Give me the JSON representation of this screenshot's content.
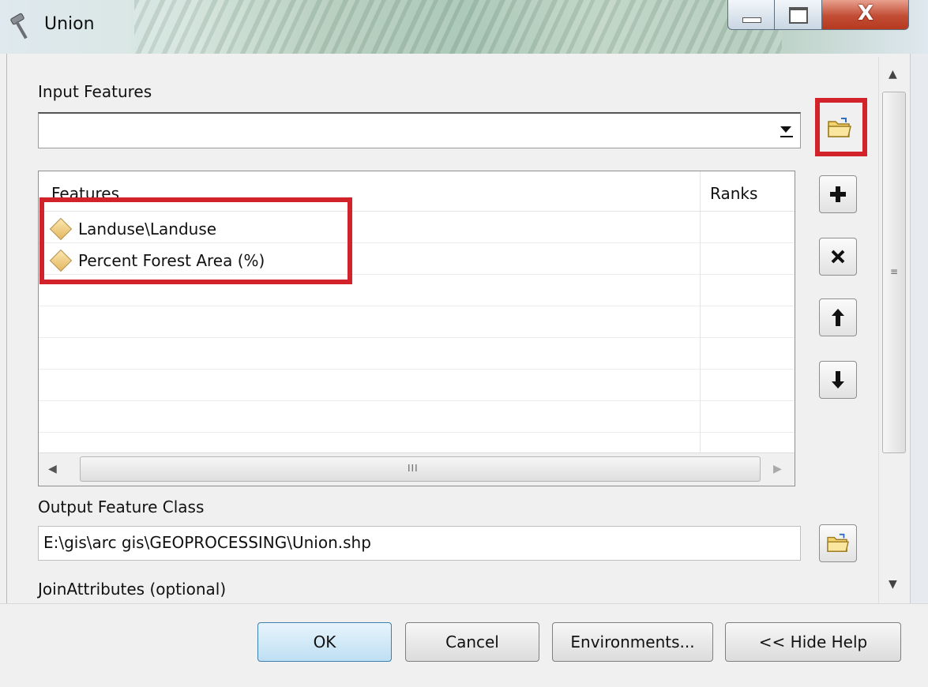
{
  "window": {
    "title": "Union",
    "close_glyph": "X"
  },
  "input_features": {
    "label": "Input Features",
    "value": "",
    "table": {
      "columns": [
        "Features",
        "Ranks"
      ],
      "rows": [
        {
          "feature": "Landuse\\Landuse",
          "rank": ""
        },
        {
          "feature": "Percent Forest Area (%)",
          "rank": ""
        }
      ],
      "hscroll_grip": "III"
    }
  },
  "output_feature_class": {
    "label": "Output Feature Class",
    "value": "E:\\gis\\arc gis\\GEOPROCESSING\\Union.shp"
  },
  "join_attributes": {
    "label": "JoinAttributes (optional)"
  },
  "side_buttons": {
    "add": "+",
    "remove": "×",
    "up": "↑",
    "down": "↓"
  },
  "buttons": {
    "ok": "OK",
    "cancel": "Cancel",
    "environments": "Environments...",
    "hide_help": "<< Hide Help"
  },
  "scroll_grip": "≡",
  "colors": {
    "highlight": "#d2232a",
    "ok_button": "#bedff3",
    "close_button": "#c24d35"
  },
  "icons": [
    "hammer-icon",
    "browse-folder-icon",
    "feature-class-icon",
    "dropdown-arrow-icon"
  ]
}
